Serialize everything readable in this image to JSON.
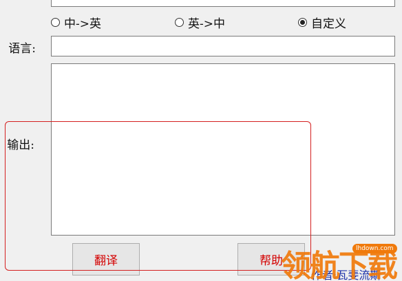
{
  "mode_options": [
    {
      "label": "中->英",
      "selected": false
    },
    {
      "label": "英->中",
      "selected": false
    },
    {
      "label": "自定义",
      "selected": true
    }
  ],
  "language_label": "语言:",
  "language_value": "",
  "output_label": "输出:",
  "output_value": "",
  "buttons": {
    "translate": "翻译",
    "help": "帮助"
  },
  "author_text": "作者:瓦斐流斯",
  "watermark": {
    "chars": "领航下载",
    "url": "lhdown.com"
  },
  "colors": {
    "accent_red": "#d41f1f",
    "button_text": "#d40000",
    "author_blue": "#1a2fa8",
    "watermark_orange": "#f07a0c"
  }
}
